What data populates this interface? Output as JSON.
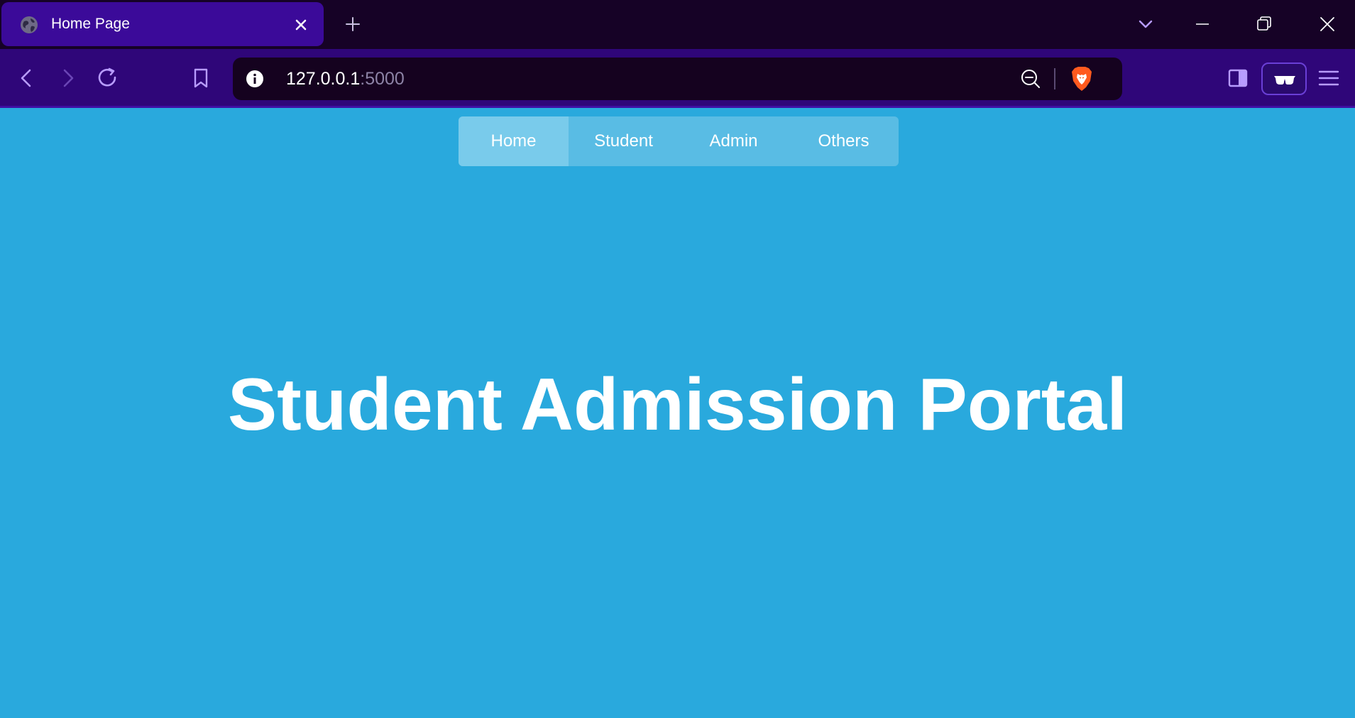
{
  "browser": {
    "tab": {
      "title": "Home Page",
      "favicon": "globe-icon"
    },
    "new_tab_icon": "plus-icon",
    "window_controls": [
      "chevron-down-icon",
      "minimize-icon",
      "restore-icon",
      "close-icon"
    ],
    "toolbar": {
      "back_icon": "back-arrow-icon",
      "forward_icon": "forward-arrow-icon",
      "reload_icon": "reload-icon",
      "bookmark_icon": "bookmark-icon",
      "address": {
        "host": "127.0.0.1",
        "port": ":5000",
        "info_icon": "info-icon",
        "zoom_icon": "zoom-out-icon",
        "shields_icon": "brave-lion-icon"
      },
      "sidebar_icon": "sidebar-icon",
      "reader_icon": "glasses-icon",
      "menu_icon": "hamburger-menu-icon"
    },
    "colors": {
      "tabstrip": "#160226",
      "active_tab": "#3b0a99",
      "toolbar": "#2f0679",
      "omnibox": "#15021f",
      "accent": "#b89cff"
    }
  },
  "page": {
    "nav": {
      "items": [
        {
          "label": "Home",
          "active": true
        },
        {
          "label": "Student",
          "active": false
        },
        {
          "label": "Admin",
          "active": false
        },
        {
          "label": "Others",
          "active": false
        }
      ]
    },
    "title": "Student Admission Portal",
    "colors": {
      "background": "#29a9dd",
      "nav_bar": "#59bce4",
      "nav_active": "#79cbeb",
      "text": "#ffffff"
    }
  }
}
